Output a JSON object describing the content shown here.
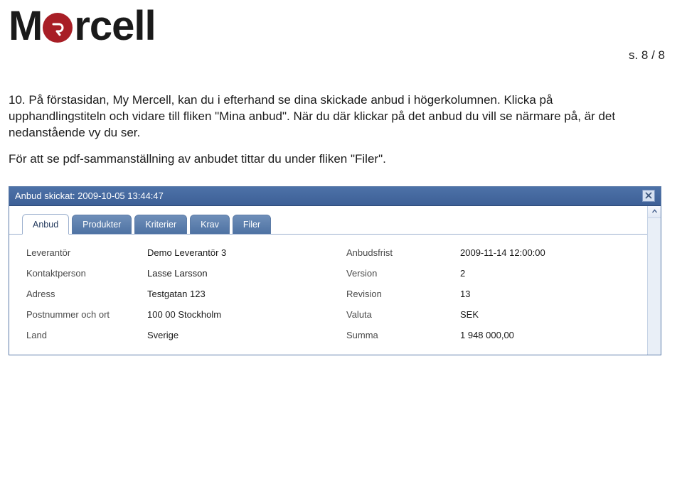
{
  "brand": "Mercell",
  "page_indicator": "s. 8 / 8",
  "instruction": "10. På förstasidan, My Mercell, kan du i efterhand se dina skickade anbud i högerkolumnen. Klicka på upphandlingstiteln och vidare till fliken \"Mina anbud\". När du där klickar på det anbud du vill se närmare på, är det nedanstående vy du ser.",
  "instruction_footer": "För att se pdf-sammanställning av anbudet tittar du under fliken \"Filer\".",
  "screenshot": {
    "window_title": "Anbud skickat: 2009-10-05 13:44:47",
    "tabs": [
      {
        "label": "Anbud",
        "active": true
      },
      {
        "label": "Produkter",
        "active": false
      },
      {
        "label": "Kriterier",
        "active": false
      },
      {
        "label": "Krav",
        "active": false
      },
      {
        "label": "Filer",
        "active": false
      }
    ],
    "details_rows": [
      {
        "label1": "Leverantör",
        "value1": "Demo Leverantör 3",
        "label2": "Anbudsfrist",
        "value2": "2009-11-14 12:00:00"
      },
      {
        "label1": "Kontaktperson",
        "value1": "Lasse Larsson",
        "label2": "Version",
        "value2": "2"
      },
      {
        "label1": "Adress",
        "value1": "Testgatan 123",
        "label2": "Revision",
        "value2": "13"
      },
      {
        "label1": "Postnummer och ort",
        "value1": "100 00 Stockholm",
        "label2": "Valuta",
        "value2": "SEK"
      },
      {
        "label1": "Land",
        "value1": "Sverige",
        "label2": "Summa",
        "value2": "1 948 000,00"
      }
    ]
  }
}
